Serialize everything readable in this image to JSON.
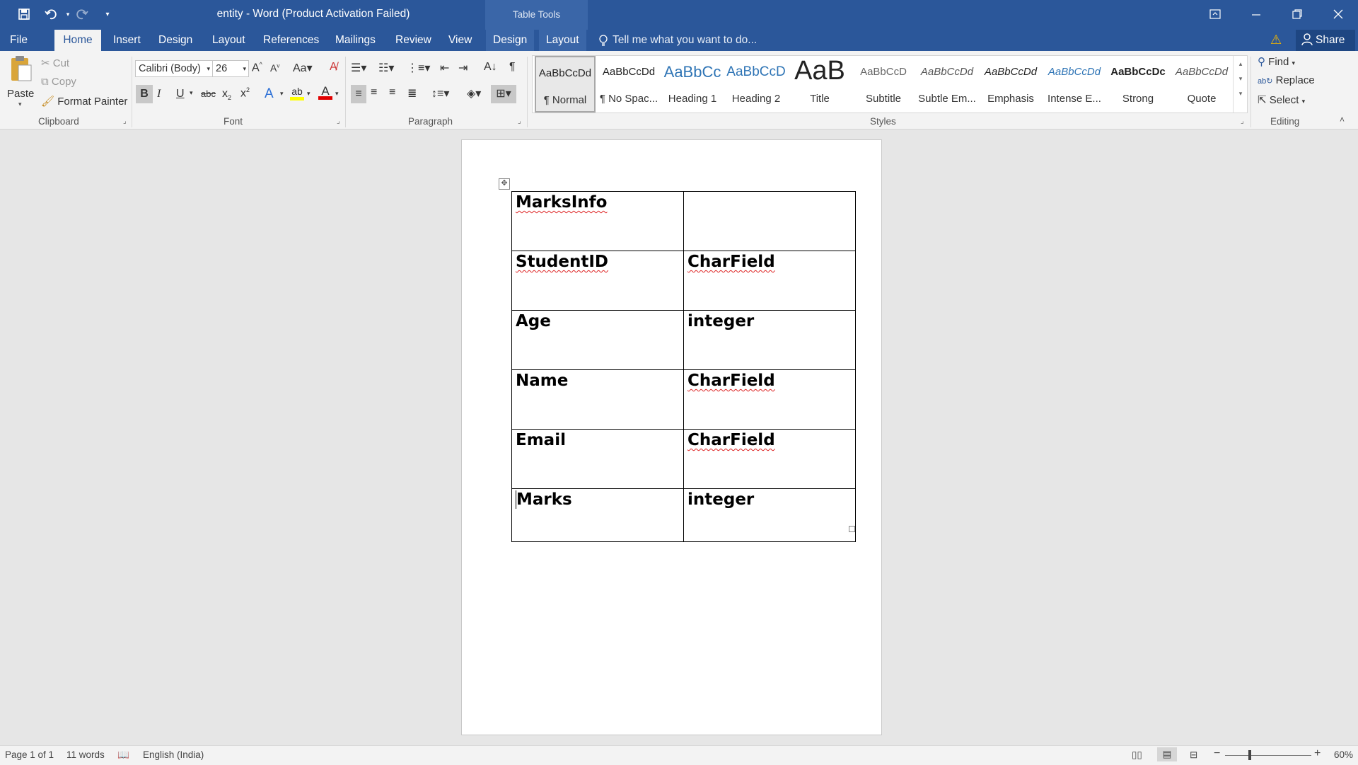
{
  "window": {
    "title": "entity - Word (Product Activation Failed)",
    "context_tab": "Table Tools"
  },
  "tabs": [
    "File",
    "Home",
    "Insert",
    "Design",
    "Layout",
    "References",
    "Mailings",
    "Review",
    "View",
    "Design",
    "Layout"
  ],
  "tell_me": "Tell me what you want to do...",
  "share": "Share",
  "clipboard": {
    "paste": "Paste",
    "cut": "Cut",
    "copy": "Copy",
    "format_painter": "Format Painter",
    "label": "Clipboard"
  },
  "font": {
    "name": "Calibri (Body)",
    "size": "26",
    "label": "Font"
  },
  "paragraph": {
    "label": "Paragraph"
  },
  "styles": {
    "label": "Styles",
    "items": [
      {
        "sample": "AaBbCcDd",
        "name": "¶ Normal"
      },
      {
        "sample": "AaBbCcDd",
        "name": "¶ No Spac..."
      },
      {
        "sample": "AaBbCc",
        "name": "Heading 1"
      },
      {
        "sample": "AaBbCcD",
        "name": "Heading 2"
      },
      {
        "sample": "AaB",
        "name": "Title"
      },
      {
        "sample": "AaBbCcD",
        "name": "Subtitle"
      },
      {
        "sample": "AaBbCcDd",
        "name": "Subtle Em..."
      },
      {
        "sample": "AaBbCcDd",
        "name": "Emphasis"
      },
      {
        "sample": "AaBbCcDd",
        "name": "Intense E..."
      },
      {
        "sample": "AaBbCcDc",
        "name": "Strong"
      },
      {
        "sample": "AaBbCcDd",
        "name": "Quote"
      }
    ]
  },
  "editing": {
    "find": "Find",
    "replace": "Replace",
    "select": "Select",
    "label": "Editing"
  },
  "table": {
    "rows": [
      [
        "MarksInfo",
        ""
      ],
      [
        "StudentID",
        "CharField"
      ],
      [
        "Age",
        "integer"
      ],
      [
        "Name",
        "CharField"
      ],
      [
        "Email",
        "CharField"
      ],
      [
        "Marks",
        "integer"
      ]
    ]
  },
  "status": {
    "page": "Page 1 of 1",
    "words": "11 words",
    "language": "English (India)",
    "zoom": "60%"
  },
  "colors": {
    "accent": "#2b579a",
    "highlight": "#ffff00",
    "font_color": "#e00000"
  }
}
